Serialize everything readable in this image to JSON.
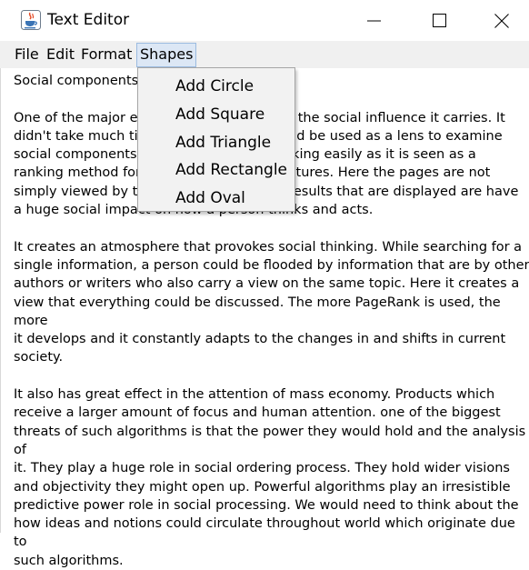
{
  "window": {
    "title": "Text Editor"
  },
  "icons": {
    "app": "java-cup-icon",
    "minimize": "minimize-icon",
    "maximize": "maximize-icon",
    "close": "close-icon"
  },
  "menubar": {
    "file": "File",
    "edit": "Edit",
    "format": "Format",
    "shapes": "Shapes"
  },
  "shapes_menu": {
    "items": [
      "Add Circle",
      "Add Square",
      "Add Triangle",
      "Add Rectangle",
      "Add Oval"
    ]
  },
  "document": {
    "text": "Social components\n\nOne of the major e                                    t the social influence it carries. It\ndidn't take much ti                                   uld be used as a lens to examine\nsocial components.                                  nking easily as it is seen as a\nranking method for                                   ntures. Here the pages are not\nsimply viewed by th                                  results that are displayed are have\na huge social impact on how a person thinks and acts.\n\nIt creates an atmosphere that provokes social thinking. While searching for a\nsingle information, a person could be flooded by information that are by other\nauthors or writers who also carry a view on the same topic. Here it creates a\nview that everything could be discussed. The more PageRank is used, the more\nit develops and it constantly adapts to the changes in and shifts in current\nsociety.\n\nIt also has great effect in the attention of mass economy. Products which\nreceive a larger amount of focus and human attention. one of the biggest\nthreats of such algorithms is that the power they would hold and the analysis of\nit. They play a huge role in social ordering process. They hold wider visions\nand objectivity they might open up. Powerful algorithms play an irresistible\npredictive power role in social processing. We would need to think about the\nhow ideas and notions could circulate throughout world which originate due to\nsuch algorithms."
  },
  "colors": {
    "menu_highlight": "#dce7f5",
    "menu_highlight_border": "#9bbbe0",
    "menubar_bg": "#f0f0f0",
    "popup_bg": "#f2f2f2"
  }
}
